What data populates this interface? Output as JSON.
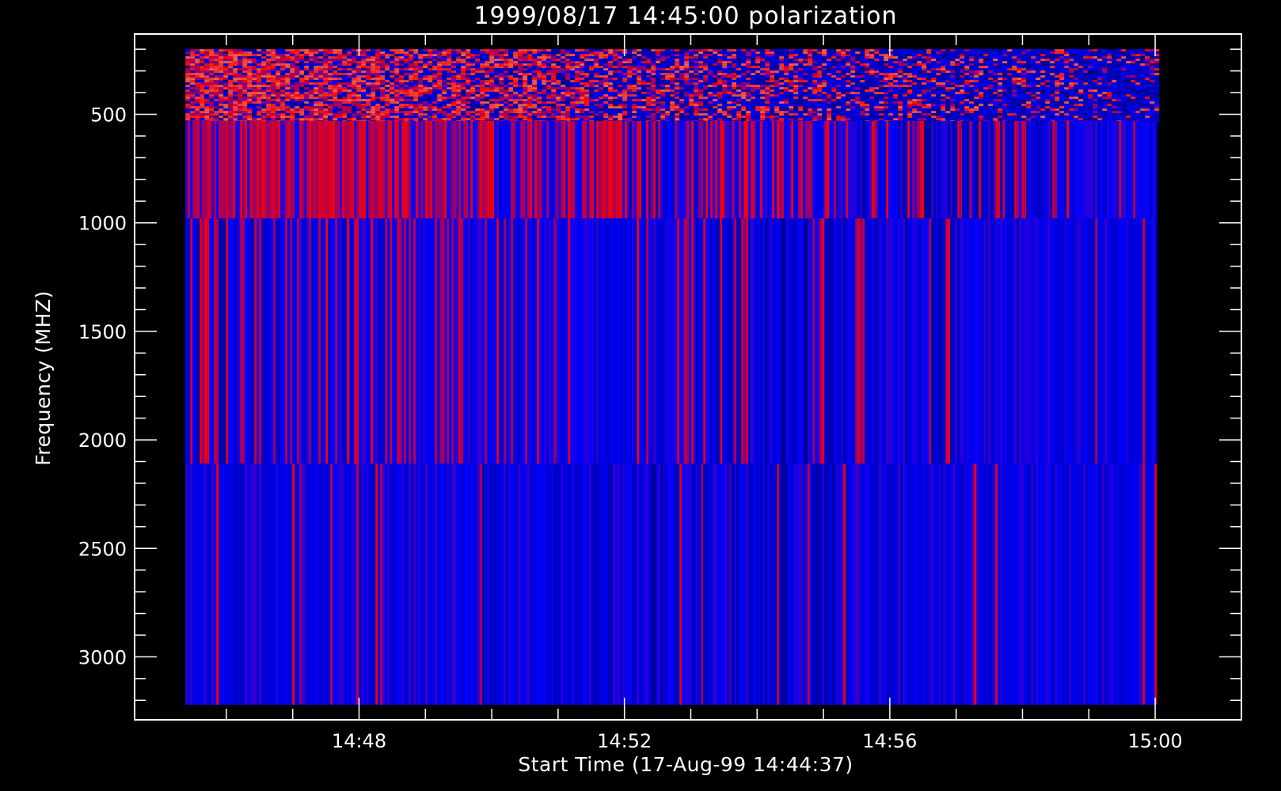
{
  "chart_data": {
    "type": "heatmap",
    "title": "1999/08/17 14:45:00 polarization",
    "xlabel": "Start Time (17-Aug-99 14:44:37)",
    "ylabel": "Frequency (MHZ)",
    "x_axis": {
      "unit": "time",
      "range": [
        "14:44:37",
        "15:01:18"
      ],
      "data_range": [
        "14:45:23",
        "15:00:00"
      ],
      "major_ticks": [
        "14:48",
        "14:52",
        "14:56",
        "15:00"
      ],
      "minor_tick_interval_minutes": 1
    },
    "y_axis": {
      "unit": "MHz",
      "reversed": true,
      "range": [
        130,
        3290
      ],
      "data_range": [
        200,
        3220
      ],
      "major_ticks": [
        500,
        1000,
        1500,
        2000,
        2500,
        3000
      ],
      "minor_tick_interval": 100
    },
    "bands": [
      {
        "freq_range": [
          200,
          530
        ],
        "pattern": "horizontal-lines",
        "dominant": "mixed red/blue",
        "red_fraction_start": 0.8,
        "red_fraction_end": 0.15
      },
      {
        "freq_range": [
          530,
          980
        ],
        "pattern": "vertical-stripes",
        "dominant": "red fading to blue",
        "red_fraction_start": 0.9,
        "red_fraction_end": 0.05
      },
      {
        "freq_range": [
          980,
          2110
        ],
        "pattern": "vertical-stripes",
        "dominant": "blue",
        "red_fraction_start": 0.3,
        "red_fraction_end": 0.05
      },
      {
        "freq_range": [
          2110,
          3220
        ],
        "pattern": "vertical-stripes",
        "dominant": "blue",
        "red_fraction_start": 0.05,
        "red_fraction_end": 0.03
      }
    ],
    "colors": {
      "background": "#000000",
      "foreground": "#ffffff",
      "low": "#0000ff",
      "high": "#ff0000",
      "dark": "#000050"
    },
    "grid": false,
    "legend": "none"
  }
}
